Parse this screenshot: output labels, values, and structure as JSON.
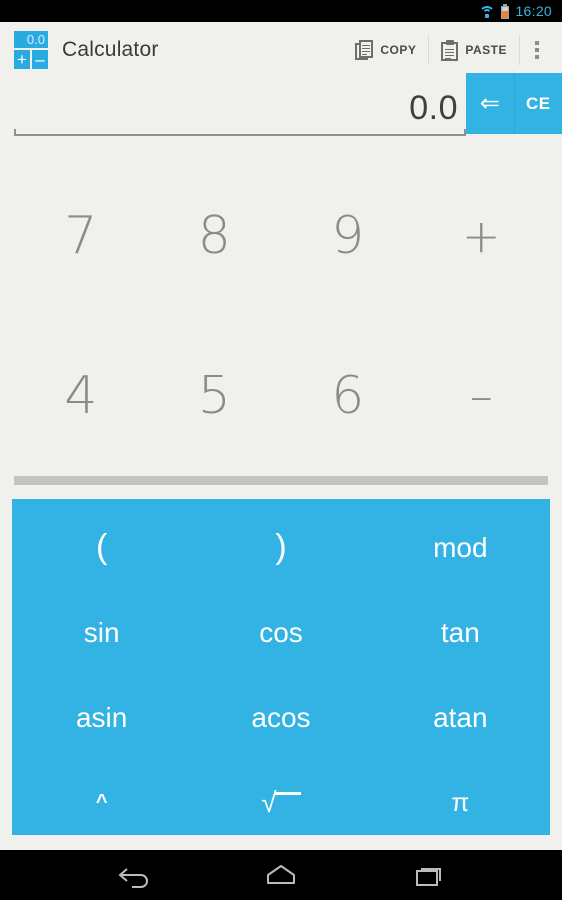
{
  "status_bar": {
    "wifi_icon": "wifi-icon",
    "battery_icon": "battery-icon",
    "time": "16:20",
    "accent_color": "#33b5e5"
  },
  "action_bar": {
    "app_icon": "calculator-app-icon",
    "app_icon_display": "0.0",
    "app_icon_plus": "+",
    "app_icon_minus": "–",
    "title": "Calculator",
    "actions": [
      {
        "name": "copy",
        "label": "COPY",
        "icon": "copy-icon"
      },
      {
        "name": "paste",
        "label": "PASTE",
        "icon": "paste-icon"
      }
    ],
    "overflow_icon": "more-vert-icon"
  },
  "display": {
    "value": "0.0",
    "backspace_label": "⇐",
    "backspace_icon": "backspace-arrow-icon",
    "clear_label": "CE",
    "button_color": "#33b3e3"
  },
  "keypad": {
    "rows": [
      [
        {
          "name": "seven",
          "label": "7",
          "type": "digit"
        },
        {
          "name": "eight",
          "label": "8",
          "type": "digit"
        },
        {
          "name": "nine",
          "label": "9",
          "type": "digit"
        },
        {
          "name": "plus",
          "label": "+",
          "type": "operator"
        }
      ],
      [
        {
          "name": "four",
          "label": "4",
          "type": "digit"
        },
        {
          "name": "five",
          "label": "5",
          "type": "digit"
        },
        {
          "name": "six",
          "label": "6",
          "type": "digit"
        },
        {
          "name": "minus",
          "label": "–",
          "type": "operator"
        }
      ]
    ]
  },
  "function_panel": {
    "background_color": "#33b3e3",
    "rows": [
      [
        {
          "name": "open-paren",
          "label": "("
        },
        {
          "name": "close-paren",
          "label": ")"
        },
        {
          "name": "mod",
          "label": "mod"
        }
      ],
      [
        {
          "name": "sin",
          "label": "sin"
        },
        {
          "name": "cos",
          "label": "cos"
        },
        {
          "name": "tan",
          "label": "tan"
        }
      ],
      [
        {
          "name": "asin",
          "label": "asin"
        },
        {
          "name": "acos",
          "label": "acos"
        },
        {
          "name": "atan",
          "label": "atan"
        }
      ],
      [
        {
          "name": "power",
          "label": "^"
        },
        {
          "name": "sqrt",
          "label": "√"
        },
        {
          "name": "pi",
          "label": "π"
        }
      ]
    ]
  },
  "nav_bar": {
    "back_icon": "back-arrow-icon",
    "home_icon": "home-icon",
    "recents_icon": "recent-apps-icon"
  }
}
